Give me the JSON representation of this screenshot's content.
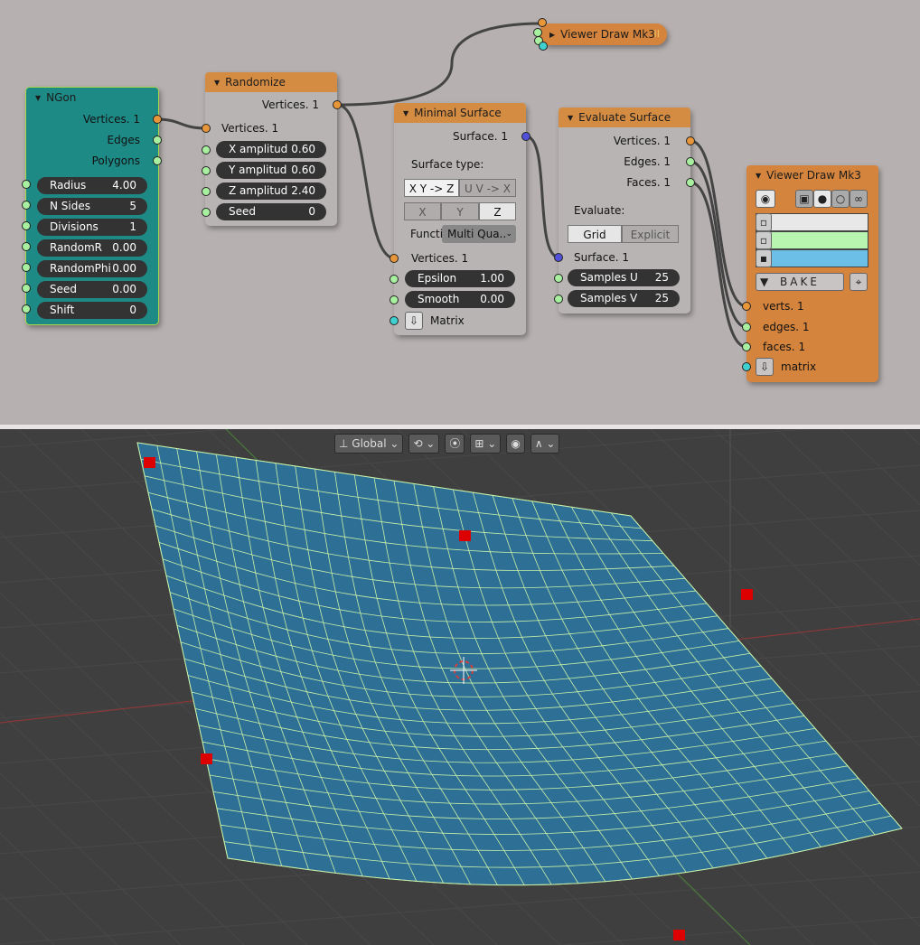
{
  "nodes": {
    "ngon": {
      "title": "NGon",
      "outputs": [
        "Vertices. 1",
        "Edges",
        "Polygons"
      ],
      "fields": [
        {
          "label": "Radius",
          "value": "4.00"
        },
        {
          "label": "N Sides",
          "value": "5"
        },
        {
          "label": "Divisions",
          "value": "1"
        },
        {
          "label": "RandomR",
          "value": "0.00"
        },
        {
          "label": "RandomPhi",
          "value": "0.00"
        },
        {
          "label": "Seed",
          "value": "0.00"
        },
        {
          "label": "Shift",
          "value": "0"
        }
      ]
    },
    "randomize": {
      "title": "Randomize",
      "output": "Vertices. 1",
      "input": "Vertices. 1",
      "fields": [
        {
          "label": "X amplitud",
          "value": "0.60"
        },
        {
          "label": "Y amplitud",
          "value": "0.60"
        },
        {
          "label": "Z amplitud",
          "value": "2.40"
        },
        {
          "label": "Seed",
          "value": "0"
        }
      ]
    },
    "viewer_top": {
      "title": "Viewer Draw Mk3",
      "badge": "II"
    },
    "minimal_surface": {
      "title": "Minimal Surface",
      "output": "Surface. 1",
      "surface_type_label": "Surface type:",
      "surface_types": [
        "X Y -> Z",
        "U V -> X .."
      ],
      "axes": [
        "X",
        "Y",
        "Z"
      ],
      "function_label": "Functi",
      "function_value": "Multi Qua..",
      "input": "Vertices. 1",
      "fields": [
        {
          "label": "Epsilon",
          "value": "1.00"
        },
        {
          "label": "Smooth",
          "value": "0.00"
        }
      ],
      "matrix_label": "Matrix"
    },
    "evaluate_surface": {
      "title": "Evaluate Surface",
      "outputs": [
        "Vertices. 1",
        "Edges. 1",
        "Faces. 1"
      ],
      "evaluate_label": "Evaluate:",
      "modes": [
        "Grid",
        "Explicit"
      ],
      "input": "Surface. 1",
      "fields": [
        {
          "label": "Samples U",
          "value": "25"
        },
        {
          "label": "Samples V",
          "value": "25"
        }
      ]
    },
    "viewer_right": {
      "title": "Viewer Draw Mk3",
      "bake_label": "BAKE",
      "inputs": [
        "verts. 1",
        "edges. 1",
        "faces. 1",
        "matrix"
      ],
      "swatch_colors": [
        "#e8e8e8",
        "#b8f5b0",
        "#6cc0e8"
      ]
    }
  },
  "viewport_toolbar": {
    "orientation": "Global"
  },
  "colors": {
    "node_header": "#d48c43",
    "ngon_bg": "#1e8a86",
    "surface_fill": "#2e6f95",
    "mesh_edges": "#c8f0a8",
    "control_points": "#dd0000"
  },
  "icons": [
    "eye-icon",
    "cube-icon",
    "sphere-icon",
    "ring-icon",
    "link-icon",
    "cursor-icon",
    "proportional-icon",
    "snap-icon",
    "funnel-icon",
    "target-icon",
    "matrix-icon"
  ]
}
